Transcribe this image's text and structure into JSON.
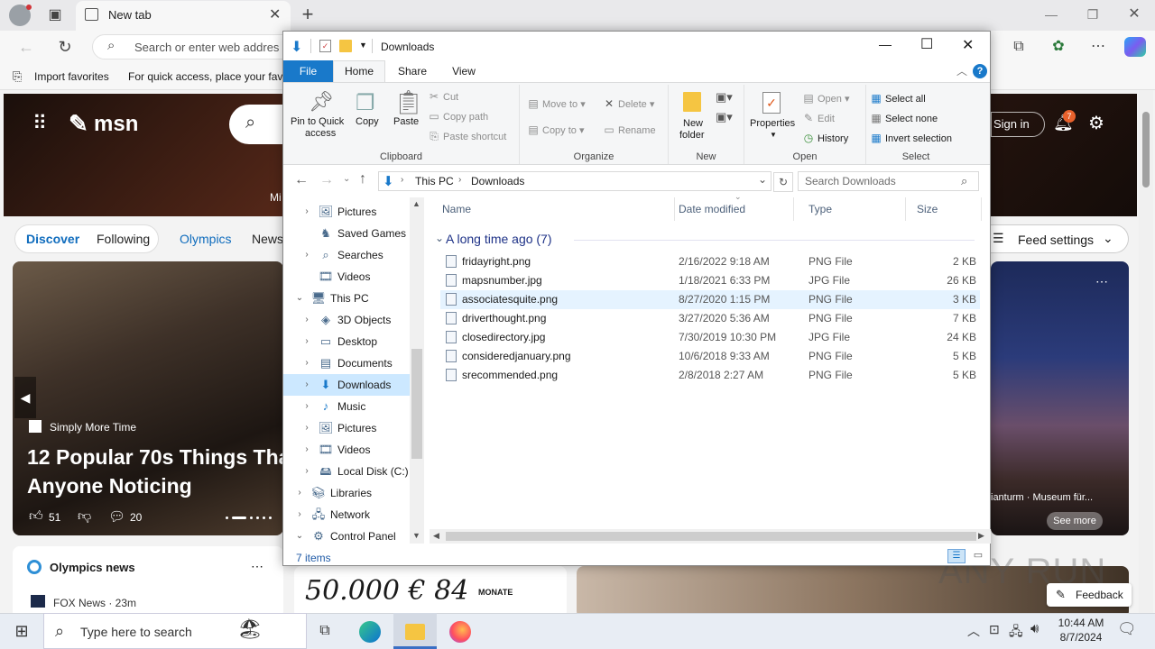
{
  "browser": {
    "tab_title": "New tab",
    "omnibox_placeholder": "Search or enter web addres",
    "favbar": {
      "import_label": "Import favorites",
      "quick_access_text": "For quick access, place your favo"
    }
  },
  "msn": {
    "logo_text": "msn",
    "hero_partial_text": "Mi",
    "sign_in": "Sign in",
    "notification_count": "7",
    "nav": {
      "discover": "Discover",
      "following": "Following",
      "olympics": "Olympics",
      "news": "News"
    },
    "feed_settings": "Feed settings",
    "hero_card": {
      "source": "Simply More Time",
      "headline_line1": "12 Popular 70s Things Tha",
      "headline_line2": "Anyone Noticing",
      "likes": "51",
      "comments": "20"
    },
    "right_card": {
      "caption": "ianturm · Museum für...",
      "see_more": "See more"
    },
    "olympics_news": {
      "title": "Olympics news",
      "item": "FOX News · 23m"
    },
    "ad_text": "50.000 € 84",
    "ad_small": "MONATE",
    "feedback": "Feedback",
    "watermark": "ANY RUN"
  },
  "explorer": {
    "title": "Downloads",
    "ribbon_tabs": {
      "file": "File",
      "home": "Home",
      "share": "Share",
      "view": "View"
    },
    "clipboard": {
      "label": "Clipboard",
      "pin_line1": "Pin to Quick",
      "pin_line2": "access",
      "copy": "Copy",
      "paste": "Paste",
      "cut": "Cut",
      "copy_path": "Copy path",
      "paste_shortcut": "Paste shortcut"
    },
    "organize": {
      "label": "Organize",
      "move_to": "Move to",
      "copy_to": "Copy to",
      "delete": "Delete",
      "rename": "Rename"
    },
    "new_group": {
      "label": "New",
      "new_folder_line1": "New",
      "new_folder_line2": "folder"
    },
    "open_group": {
      "label": "Open",
      "properties": "Properties",
      "open": "Open",
      "edit": "Edit",
      "history": "History"
    },
    "select_group": {
      "label": "Select",
      "select_all": "Select all",
      "select_none": "Select none",
      "invert": "Invert selection"
    },
    "breadcrumb": {
      "root": "This PC",
      "current": "Downloads"
    },
    "search_placeholder": "Search Downloads",
    "nav_items": [
      {
        "label": "Pictures",
        "icon": "pictures-icon",
        "expand": true
      },
      {
        "label": "Saved Games",
        "icon": "saved-games-icon",
        "expand": false
      },
      {
        "label": "Searches",
        "icon": "search-icon",
        "expand": true
      },
      {
        "label": "Videos",
        "icon": "videos-icon",
        "expand": false
      },
      {
        "label": "This PC",
        "icon": "pc-icon",
        "expand": "open"
      },
      {
        "label": "3D Objects",
        "icon": "3d-objects-icon",
        "expand": true
      },
      {
        "label": "Desktop",
        "icon": "desktop-icon",
        "expand": true
      },
      {
        "label": "Documents",
        "icon": "documents-icon",
        "expand": true
      },
      {
        "label": "Downloads",
        "icon": "downloads-icon",
        "expand": true
      },
      {
        "label": "Music",
        "icon": "music-icon",
        "expand": true
      },
      {
        "label": "Pictures",
        "icon": "pictures-icon",
        "expand": true
      },
      {
        "label": "Videos",
        "icon": "videos-icon",
        "expand": true
      },
      {
        "label": "Local Disk (C:)",
        "icon": "disk-icon",
        "expand": true
      },
      {
        "label": "Libraries",
        "icon": "libraries-icon",
        "expand": true
      },
      {
        "label": "Network",
        "icon": "network-icon",
        "expand": true
      },
      {
        "label": "Control Panel",
        "icon": "control-panel-icon",
        "expand": "open"
      }
    ],
    "columns": {
      "name": "Name",
      "date": "Date modified",
      "type": "Type",
      "size": "Size"
    },
    "group_header": "A long time ago (7)",
    "files": [
      {
        "name": "fridayright.png",
        "date": "2/16/2022 9:18 AM",
        "type": "PNG File",
        "size": "2 KB"
      },
      {
        "name": "mapsnumber.jpg",
        "date": "1/18/2021 6:33 PM",
        "type": "JPG File",
        "size": "26 KB"
      },
      {
        "name": "associatesquite.png",
        "date": "8/27/2020 1:15 PM",
        "type": "PNG File",
        "size": "3 KB"
      },
      {
        "name": "driverthought.png",
        "date": "3/27/2020 5:36 AM",
        "type": "PNG File",
        "size": "7 KB"
      },
      {
        "name": "closedirectory.jpg",
        "date": "7/30/2019 10:30 PM",
        "type": "JPG File",
        "size": "24 KB"
      },
      {
        "name": "consideredjanuary.png",
        "date": "10/6/2018 9:33 AM",
        "type": "PNG File",
        "size": "5 KB"
      },
      {
        "name": "srecommended.png",
        "date": "2/8/2018 2:27 AM",
        "type": "PNG File",
        "size": "5 KB"
      }
    ],
    "status": "7 items"
  },
  "taskbar": {
    "search_placeholder": "Type here to search",
    "time": "10:44 AM",
    "date": "8/7/2024"
  },
  "colors": {
    "accent": "#1979ca",
    "selection": "#e5f3ff",
    "msn_blue": "#0f6cbd"
  }
}
